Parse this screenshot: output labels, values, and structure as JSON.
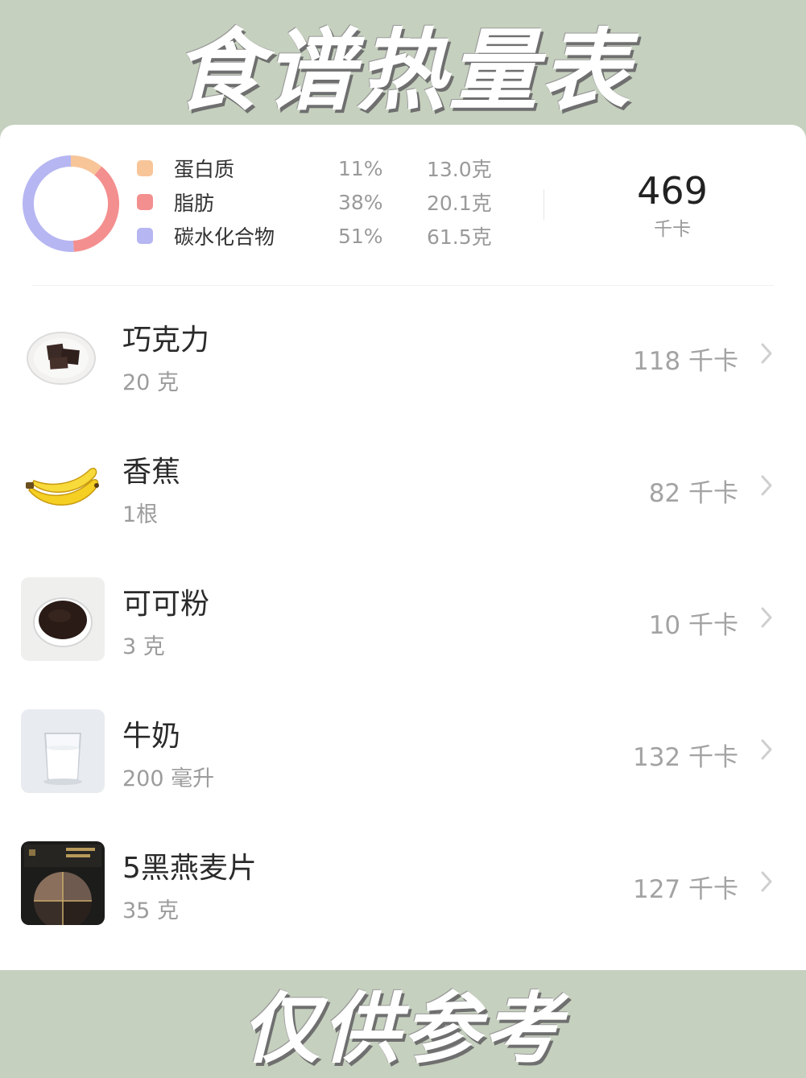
{
  "header": {
    "title": "食谱热量表"
  },
  "footer": {
    "text": "仅供参考"
  },
  "colors": {
    "protein": "#f8c599",
    "fat": "#f48f8f",
    "carbs": "#b6b6f2",
    "background": "#c5d0be"
  },
  "summary": {
    "macros": [
      {
        "name": "蛋白质",
        "percent": "11%",
        "amount": "13.0克",
        "share": 0.11
      },
      {
        "name": "脂肪",
        "percent": "38%",
        "amount": "20.1克",
        "share": 0.38
      },
      {
        "name": "碳水化合物",
        "percent": "51%",
        "amount": "61.5克",
        "share": 0.51
      }
    ],
    "total_kcal": "469",
    "kcal_unit": "千卡"
  },
  "foods": [
    {
      "name": "巧克力",
      "quantity": "20 克",
      "kcal": "118 千卡",
      "icon": "chocolate-icon"
    },
    {
      "name": "香蕉",
      "quantity": "1根",
      "kcal": "82 千卡",
      "icon": "banana-icon"
    },
    {
      "name": "可可粉",
      "quantity": "3 克",
      "kcal": "10 千卡",
      "icon": "cocoa-powder-icon"
    },
    {
      "name": "牛奶",
      "quantity": "200 毫升",
      "kcal": "132 千卡",
      "icon": "milk-icon"
    },
    {
      "name": "5黑燕麦片",
      "quantity": "35 克",
      "kcal": "127 千卡",
      "icon": "oatmeal-icon"
    }
  ]
}
